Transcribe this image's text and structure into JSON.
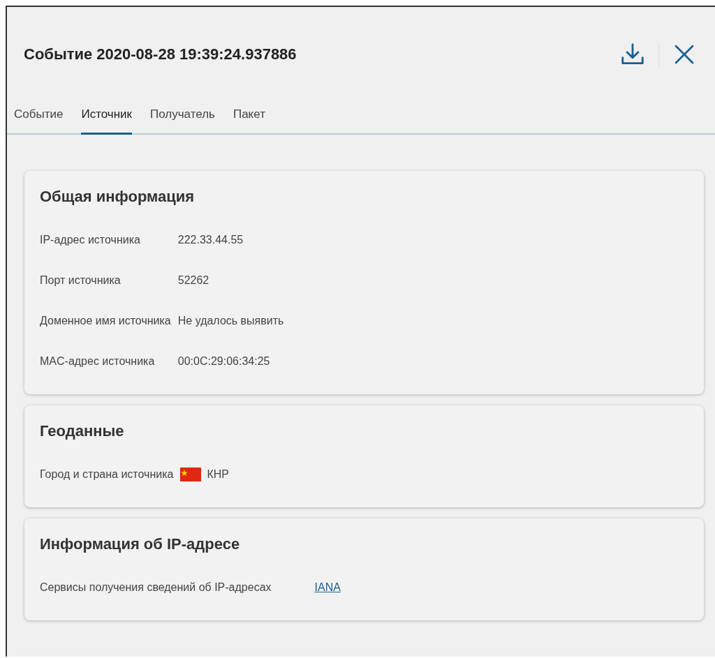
{
  "dialog": {
    "title": "Событие 2020-08-28 19:39:24.937886"
  },
  "tabs": [
    {
      "label": "Событие",
      "selected": false
    },
    {
      "label": "Источник",
      "selected": true
    },
    {
      "label": "Получатель",
      "selected": false
    },
    {
      "label": "Пакет",
      "selected": false
    }
  ],
  "sections": [
    {
      "title": "Общая информация",
      "rows": [
        {
          "kind": "text",
          "label": "IP-адрес источника",
          "value": "222.33.44.55"
        },
        {
          "kind": "text",
          "label": "Порт источника",
          "value": "52262"
        },
        {
          "kind": "text",
          "label": "Доменное имя источника",
          "value": "Не удалось выявить"
        },
        {
          "kind": "text",
          "label": "MAC-адрес источника",
          "value": "00:0C:29:06:34:25"
        }
      ]
    },
    {
      "title": "Геоданные",
      "rows": [
        {
          "kind": "flag",
          "label": "Город и страна источника",
          "value": "КНР"
        }
      ]
    },
    {
      "title": "Информация об IP-адресе",
      "rows": [
        {
          "kind": "link",
          "label": "Сервисы получения сведений об IP-адресах",
          "value": "IANA"
        }
      ]
    }
  ]
}
